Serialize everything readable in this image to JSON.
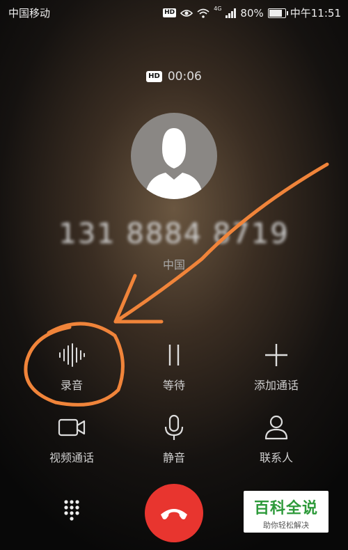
{
  "status_bar": {
    "carrier": "中国移动",
    "hd_badge": "HD",
    "network_type": "4G",
    "battery": "80%",
    "battery_level": 0.8,
    "time": "中午11:51"
  },
  "call": {
    "hd_label": "HD",
    "duration": "00:06",
    "number": "131 8884 8719",
    "location": "中国"
  },
  "actions": [
    {
      "label": "录音",
      "icon": "waveform-icon"
    },
    {
      "label": "等待",
      "icon": "pause-icon"
    },
    {
      "label": "添加通话",
      "icon": "plus-icon"
    },
    {
      "label": "视频通话",
      "icon": "video-camera-icon"
    },
    {
      "label": "静音",
      "icon": "microphone-icon"
    },
    {
      "label": "联系人",
      "icon": "person-icon"
    }
  ],
  "bottom": {
    "dialpad_icon": "dialpad-icon",
    "end_call_icon": "phone-hangup-icon",
    "end_call_color": "#e8352f"
  },
  "watermark": {
    "title": "百科全说",
    "subtitle": "助你轻松解决"
  },
  "annotation_color": "#f0843a"
}
